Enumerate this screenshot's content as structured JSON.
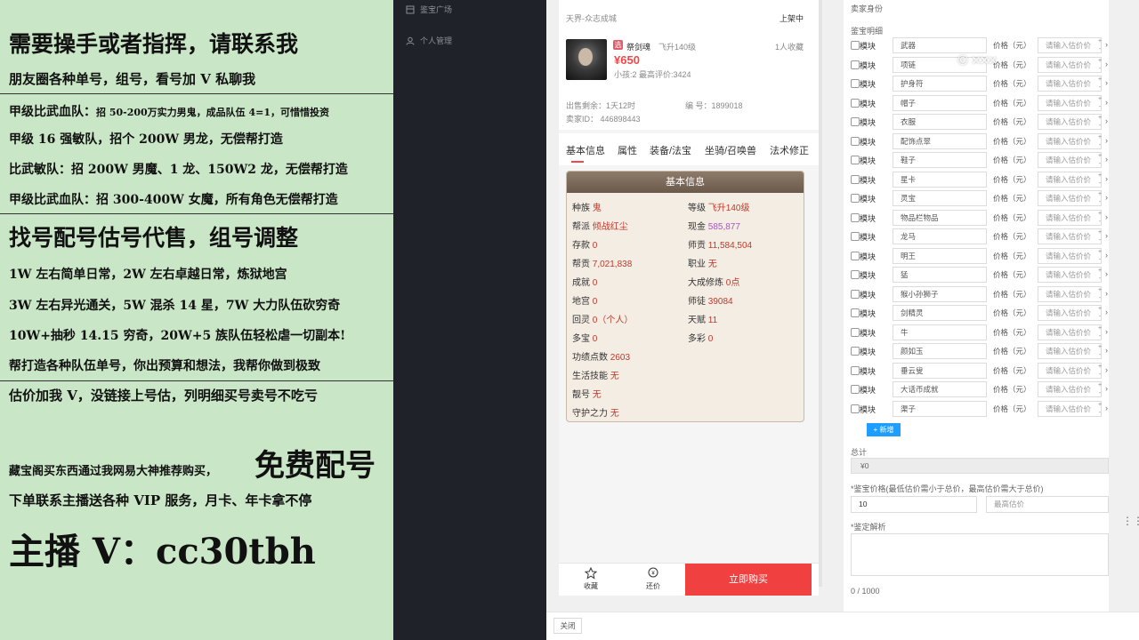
{
  "ad": {
    "lines": [
      "需要操手或者指挥，请联系我",
      "朋友圈各种单号，组号，看号加 V 私聊我",
      "甲级比武血队：",
      "招 50-200万实力男鬼，成品队伍 4=1，可惜惜投资",
      "甲级 16 强敏队，招个 200W 男龙，无偿帮打造",
      "比武敏队：招 200W 男魔、1 龙、150W2 龙，无偿帮打造",
      "甲级比武血队：招 300-400W 女魔，所有角色无偿帮打造",
      "找号配号估号代售，组号调整",
      "1W 左右简单日常，2W 左右卓越日常，炼狱地宫",
      "3W 左右异光通关，5W 混杀 14 星，7W 大力队伍砍穷奇",
      "10W+抽秒 14.15 穷奇，20W+5 族队伍轻松虐一切副本!",
      "帮打造各种队伍单号，你出预算和想法，我帮你做到极致",
      "估价加我 V，没链接上号估，列明细买号卖号不吃亏",
      "藏宝阁买东西通过我网易大神推荐购买，",
      "免费配号",
      "下单联系主播送各种 VIP 服务，月卡、年卡拿不停",
      "主播 V：cc30tbh"
    ]
  },
  "sidebar": {
    "items": [
      {
        "label": "鉴宝广场"
      },
      {
        "label": "个人管理"
      }
    ]
  },
  "product": {
    "server": "天界-众志成城",
    "status": "上架中",
    "name": "祭剑魂",
    "level": "飞升140级",
    "favorites": "1人收藏",
    "price": "¥650",
    "meta": "小孩:2 最高评价:3424",
    "remaining": "出售剩余：1天12时",
    "serial_label": "编  号：1899018",
    "seller": "卖家ID：  446898443"
  },
  "tabs": [
    "基本信息",
    "属性",
    "装备/法宝",
    "坐骑/召唤兽",
    "法术修正"
  ],
  "info": {
    "header": "基本信息",
    "left": [
      {
        "k": "种族",
        "v": "鬼"
      },
      {
        "k": "帮派",
        "v": "倾战红尘"
      },
      {
        "k": "存款",
        "v": "0"
      },
      {
        "k": "帮贡",
        "v": "7,021,838"
      },
      {
        "k": "成就",
        "v": "0"
      },
      {
        "k": "地宫",
        "v": "0"
      },
      {
        "k": "回灵",
        "v": "0（个人）"
      },
      {
        "k": "多宝",
        "v": "0"
      },
      {
        "k": "功绩点数",
        "v": "2603"
      },
      {
        "k": "生活技能",
        "v": "无"
      },
      {
        "k": "靓号",
        "v": "无"
      },
      {
        "k": "守护之力",
        "v": "无"
      }
    ],
    "right": [
      {
        "k": "等级",
        "v": "飞升140级"
      },
      {
        "k": "现金",
        "v": "585,877"
      },
      {
        "k": "师贡",
        "v": "11,584,504"
      },
      {
        "k": "职业",
        "v": "无"
      },
      {
        "k": "大成修炼",
        "v": "0点"
      },
      {
        "k": "师徒",
        "v": "39084"
      },
      {
        "k": "天赋",
        "v": "11"
      },
      {
        "k": "多彩",
        "v": "0"
      }
    ]
  },
  "footer": {
    "fav": "收藏",
    "bargain": "还价",
    "buy": "立即购买"
  },
  "form": {
    "seller_label": "卖家身份",
    "detail_label": "鉴宝明细",
    "module_label": "模块",
    "price_label": "价格（元）",
    "price_placeholder": "请输入估价价",
    "items": [
      "武器",
      "项链",
      "护身符",
      "帽子",
      "衣服",
      "配饰点翠",
      "鞋子",
      "星卡",
      "灵宝",
      "物品栏物品",
      "龙马",
      "明王",
      "猛",
      "猴小孙狮子",
      "剑精灵",
      "牛",
      "颜如玉",
      "垂云叟",
      "大话币成就",
      "渠子"
    ],
    "add_btn": "+ 新增",
    "total_label": "总计",
    "total_value": "¥0",
    "price_range_label": "*鉴宝价格(最低估价需小于总价，最高估价需大于总价)",
    "min_value": "10",
    "max_placeholder": "最高估价",
    "analysis_label": "*鉴定解析",
    "counter": "0 / 1000"
  },
  "bottom": {
    "close": "关闭"
  },
  "watermark": "© ×××"
}
